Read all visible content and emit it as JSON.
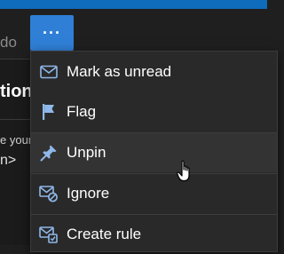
{
  "toolbar": {
    "partial_undo": "do",
    "more_label": "···"
  },
  "background": {
    "title_fragment": "tion",
    "line_left": "e your",
    "line_right": "n",
    "arrow_text": "n>"
  },
  "menu": {
    "items": [
      {
        "label": "Mark as unread",
        "icon": "envelope-icon"
      },
      {
        "label": "Flag",
        "icon": "flag-icon"
      },
      {
        "label": "Unpin",
        "icon": "pin-icon"
      },
      {
        "label": "Ignore",
        "icon": "ignore-icon"
      },
      {
        "label": "Create rule",
        "icon": "create-rule-icon"
      }
    ]
  },
  "colors": {
    "accent": "#2f7fd6",
    "top_bar": "#0f6cbd",
    "menu_bg": "#292929",
    "icon": "#8fb8ea"
  }
}
